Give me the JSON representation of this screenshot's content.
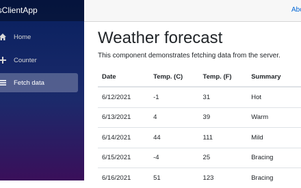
{
  "app": {
    "brand": "orsClientApp"
  },
  "nav": [
    {
      "label": "Home",
      "icon": "home-icon",
      "active": false
    },
    {
      "label": "Counter",
      "icon": "plus-icon",
      "active": false
    },
    {
      "label": "Fetch data",
      "icon": "list-icon",
      "active": true
    }
  ],
  "topbar": {
    "about": "Abo"
  },
  "page": {
    "title": "Weather forecast",
    "description": "This component demonstrates fetching data from the server."
  },
  "table": {
    "headers": [
      "Date",
      "Temp. (C)",
      "Temp. (F)",
      "Summary"
    ],
    "rows": [
      [
        "6/12/2021",
        "-1",
        "31",
        "Hot"
      ],
      [
        "6/13/2021",
        "4",
        "39",
        "Warm"
      ],
      [
        "6/14/2021",
        "44",
        "111",
        "Mild"
      ],
      [
        "6/15/2021",
        "-4",
        "25",
        "Bracing"
      ],
      [
        "6/16/2021",
        "51",
        "123",
        "Bracing"
      ]
    ]
  }
}
